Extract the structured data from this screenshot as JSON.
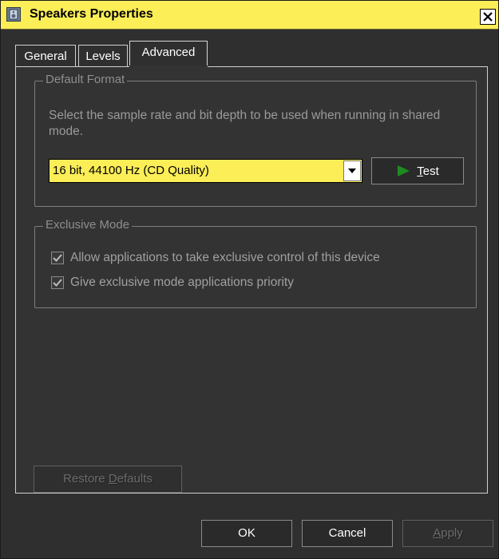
{
  "window": {
    "title": "Speakers Properties",
    "close_glyph": "✕"
  },
  "tabs": [
    {
      "label": "General",
      "active": false
    },
    {
      "label": "Levels",
      "active": false
    },
    {
      "label": "Advanced",
      "active": true
    }
  ],
  "default_format": {
    "legend": "Default Format",
    "description": "Select the sample rate and bit depth to be used when running in shared mode.",
    "format_value": "16 bit, 44100 Hz (CD Quality)",
    "test_button": {
      "label": "Test",
      "accel": "T",
      "rest": "est"
    }
  },
  "exclusive_mode": {
    "legend": "Exclusive Mode",
    "options": [
      {
        "label": "Allow applications to take exclusive control of this device",
        "checked": true
      },
      {
        "label": "Give exclusive mode applications priority",
        "checked": true
      }
    ]
  },
  "restore_defaults": {
    "label": "Restore Defaults",
    "prefix": "Restore ",
    "accel": "D",
    "rest": "efaults"
  },
  "footer": {
    "ok": "OK",
    "cancel": "Cancel",
    "apply": "Apply",
    "apply_accel": "A",
    "apply_rest": "pply"
  },
  "colors": {
    "title_bar": "#fbee57",
    "combo_highlight": "#fbee57",
    "window_bg": "#2f2f2f",
    "play_icon": "#1f8a1f"
  },
  "icons": {
    "window_icon": "speaker-icon",
    "close": "close-icon",
    "dropdown": "chevron-down-icon",
    "test": "play-icon",
    "checkbox": "checkmark-icon"
  }
}
